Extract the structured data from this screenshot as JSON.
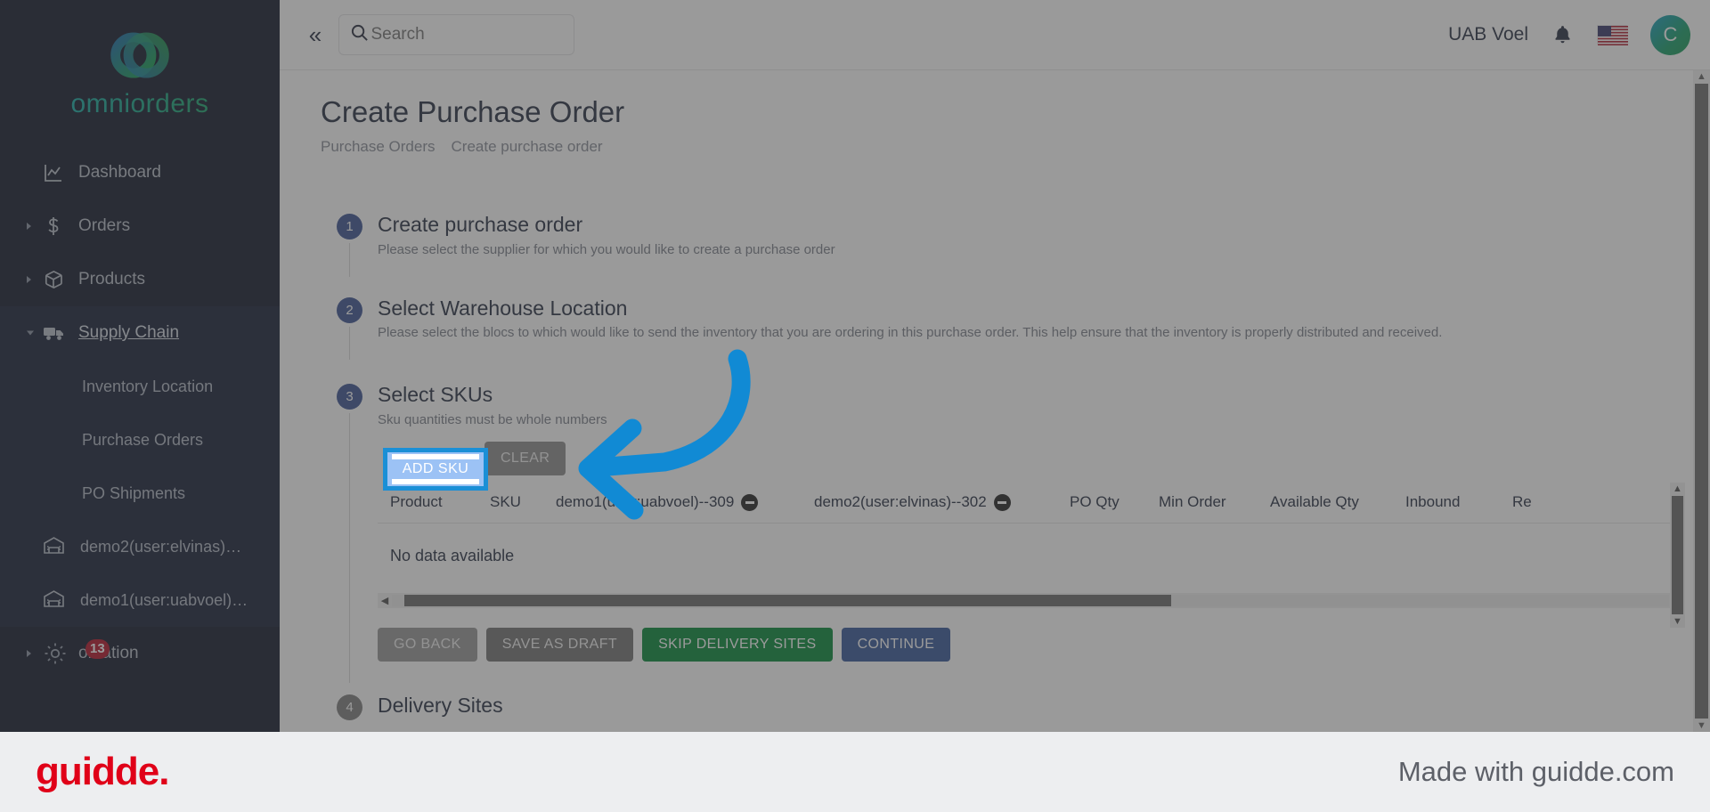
{
  "sidebar": {
    "brand": "omniorders",
    "items": [
      {
        "label": "Dashboard",
        "icon": "chart-line-icon",
        "expandable": false
      },
      {
        "label": "Orders",
        "icon": "dollar-icon",
        "expandable": true
      },
      {
        "label": "Products",
        "icon": "box-icon",
        "expandable": true
      },
      {
        "label": "Supply Chain",
        "icon": "truck-icon",
        "expandable": true,
        "active": true
      }
    ],
    "sub_items": [
      {
        "label": "Inventory Location"
      },
      {
        "label": "Purchase Orders"
      },
      {
        "label": "PO Shipments"
      }
    ],
    "warehouses": [
      {
        "label": "demo2(user:elvinas)…",
        "icon": "warehouse-icon"
      },
      {
        "label": "demo1(user:uabvoel)…",
        "icon": "warehouse-icon"
      }
    ],
    "automation": {
      "label": "omation",
      "badge": "13",
      "icon": "gear-icon"
    }
  },
  "topbar": {
    "collapse_icon": "«",
    "search_placeholder": "Search",
    "search_value": "",
    "org_name": "UAB Voel",
    "bell_icon": "bell-icon",
    "flag": "us-flag",
    "avatar_initial": "C"
  },
  "page": {
    "title": "Create Purchase Order",
    "breadcrumb": [
      "Purchase Orders",
      "Create purchase order"
    ]
  },
  "steps": [
    {
      "num": "1",
      "title": "Create purchase order",
      "desc": "Please select the supplier for which you would like to create a purchase order"
    },
    {
      "num": "2",
      "title": "Select Warehouse Location",
      "desc": "Please select the blocs to which would like to send the inventory that you are ordering in this purchase order. This help ensure that the inventory is properly distributed and received."
    },
    {
      "num": "3",
      "title": "Select SKUs",
      "desc": "Sku quantities must be whole numbers"
    },
    {
      "num": "4",
      "title": "Delivery Sites",
      "desc": ""
    }
  ],
  "sku_section": {
    "add_sku_label": "ADD SKU",
    "clear_label": "CLEAR",
    "table": {
      "columns": [
        {
          "label": "Product",
          "removable": false
        },
        {
          "label": "SKU",
          "removable": false
        },
        {
          "label": "demo1(user:uabvoel)--309",
          "removable": true
        },
        {
          "label": "demo2(user:elvinas)--302",
          "removable": true
        },
        {
          "label": "PO Qty",
          "removable": false
        },
        {
          "label": "Min Order",
          "removable": false
        },
        {
          "label": "Available Qty",
          "removable": false
        },
        {
          "label": "Inbound",
          "removable": false
        },
        {
          "label": "Re",
          "removable": false
        }
      ],
      "rows": [],
      "empty_message": "No data available"
    }
  },
  "form_actions": [
    {
      "label": "GO BACK",
      "style": "grey"
    },
    {
      "label": "SAVE AS DRAFT",
      "style": "dark"
    },
    {
      "label": "SKIP DELIVERY SITES",
      "style": "green"
    },
    {
      "label": "CONTINUE",
      "style": "blue"
    }
  ],
  "footer": {
    "brand": "guidde.",
    "made_with": "Made with guidde.com"
  },
  "colors": {
    "accent_blue": "#3f5795",
    "highlight": "#1b8fd6",
    "green": "#0a8a3c",
    "badge_red": "#b3152a"
  }
}
